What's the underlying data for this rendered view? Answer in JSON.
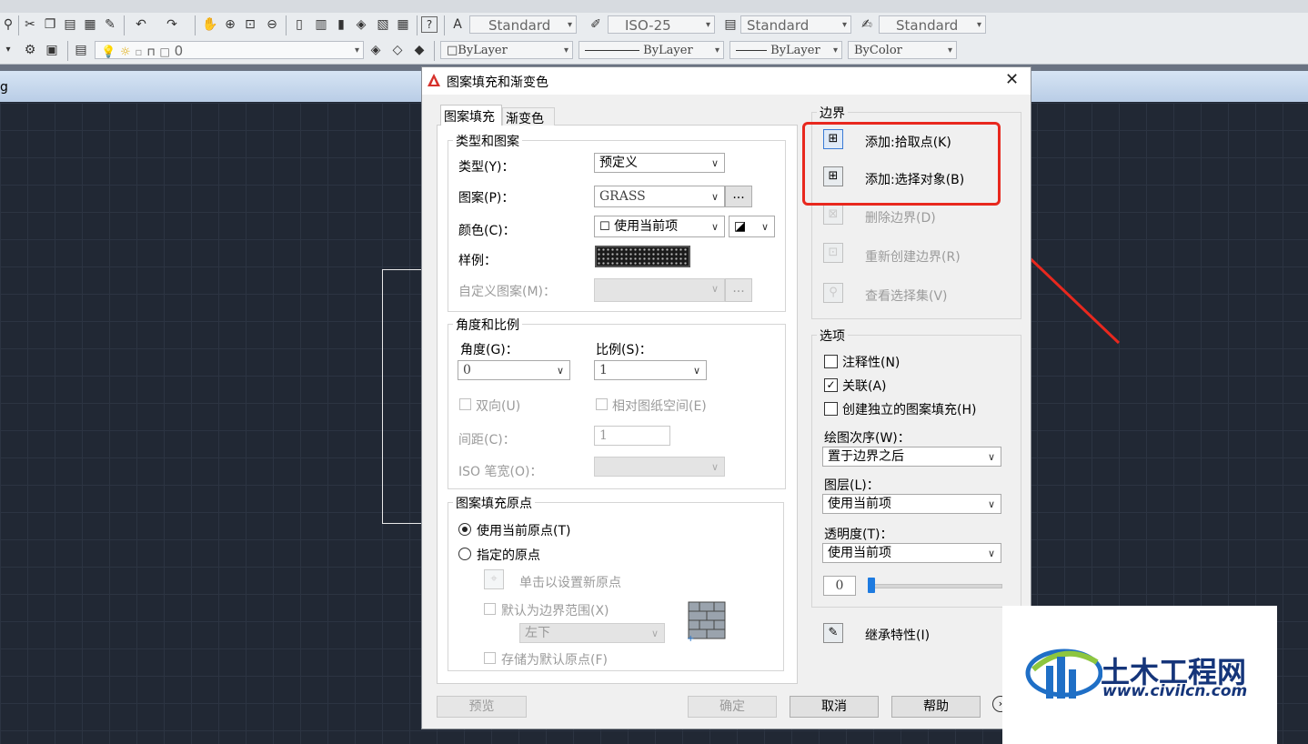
{
  "toolbar": {
    "text_style": "Standard",
    "dim_style": "ISO-25",
    "table_style": "Standard",
    "multileader_style": "Standard",
    "layer_value": "0",
    "color": "ByLayer",
    "linetype": "ByLayer",
    "lineweight": "ByLayer",
    "plotstyle": "ByColor"
  },
  "drawing": {
    "title_fragment": "g"
  },
  "dialog": {
    "title": "图案填充和渐变色",
    "close": "✕",
    "tabs": [
      "图案填充",
      "渐变色"
    ],
    "type_pattern": {
      "group": "类型和图案",
      "type_label": "类型(Y)：",
      "type_value": "预定义",
      "pattern_label": "图案(P)：",
      "pattern_value": "GRASS",
      "pattern_more": "...",
      "color_label": "颜色(C)：",
      "color_value": "使用当前项",
      "sample_label": "样例：",
      "custom_label": "自定义图案(M)：",
      "custom_more": "..."
    },
    "angle_scale": {
      "group": "角度和比例",
      "angle_label": "角度(G)：",
      "angle_value": "0",
      "scale_label": "比例(S)：",
      "scale_value": "1",
      "double_label": "双向(U)",
      "relative_label": "相对图纸空间(E)",
      "spacing_label": "间距(C)：",
      "spacing_value": "1",
      "iso_label": "ISO 笔宽(O)："
    },
    "origin": {
      "group": "图案填充原点",
      "current_label": "使用当前原点(T)",
      "specified_label": "指定的原点",
      "click_set_label": "单击以设置新原点",
      "default_extent_label": "默认为边界范围(X)",
      "extent_value": "左下",
      "store_label": "存储为默认原点(F)"
    },
    "boundary": {
      "group": "边界",
      "add_pick": "添加:拾取点(K)",
      "add_select": "添加:选择对象(B)",
      "remove": "删除边界(D)",
      "recreate": "重新创建边界(R)",
      "view": "查看选择集(V)"
    },
    "options": {
      "group": "选项",
      "annotative": "注释性(N)",
      "associative": "关联(A)",
      "separate": "创建独立的图案填充(H)",
      "draw_order_label": "绘图次序(W)：",
      "draw_order_value": "置于边界之后",
      "layer_label": "图层(L)：",
      "layer_value": "使用当前项",
      "transparency_label": "透明度(T)：",
      "transparency_value": "使用当前项",
      "transparency_num": "0"
    },
    "inherit": "继承特性(I)",
    "buttons": {
      "preview": "预览",
      "ok": "确定",
      "cancel": "取消",
      "help": "帮助"
    }
  },
  "watermark": {
    "cn": "土木工程网",
    "url": "www.civilcn.com"
  },
  "colors": {
    "highlight": "#e8281e",
    "accent": "#1f6fc6"
  }
}
